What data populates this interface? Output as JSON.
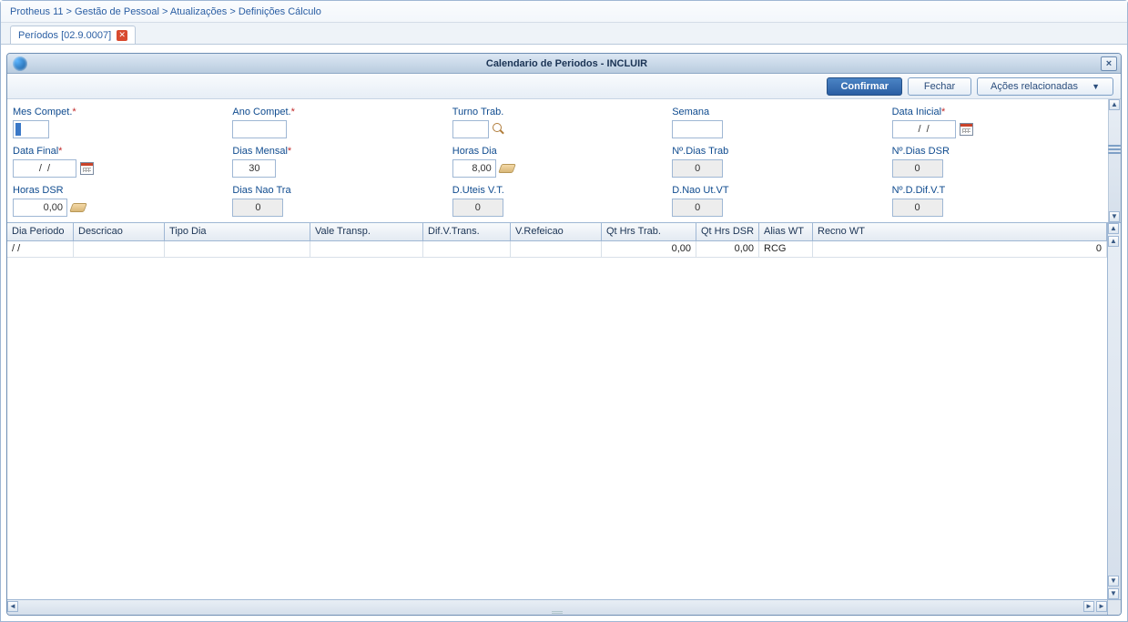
{
  "breadcrumb": "Protheus 11 > Gestão de Pessoal > Atualizações > Definições Cálculo",
  "tab": {
    "label": "Períodos [02.9.0007]"
  },
  "window": {
    "title": "Calendario de Periodos - INCLUIR"
  },
  "toolbar": {
    "confirm": "Confirmar",
    "close": "Fechar",
    "related": "Ações relacionadas"
  },
  "fields": {
    "mesCompet": {
      "label": "Mes Compet."
    },
    "anoCompet": {
      "label": "Ano Compet.",
      "value": ""
    },
    "turnoTrab": {
      "label": "Turno Trab.",
      "value": ""
    },
    "semana": {
      "label": "Semana",
      "value": ""
    },
    "dataInicial": {
      "label": "Data Inicial",
      "value": "/  /"
    },
    "dataFinal": {
      "label": "Data Final",
      "value": "/  /"
    },
    "diasMensal": {
      "label": "Dias Mensal",
      "value": "30"
    },
    "horasDia": {
      "label": "Horas Dia",
      "value": "8,00"
    },
    "nDiasTrab": {
      "label": "Nº.Dias Trab",
      "value": "0"
    },
    "nDiasDSR": {
      "label": "Nº.Dias DSR",
      "value": "0"
    },
    "horasDSR": {
      "label": "Horas DSR",
      "value": "0,00"
    },
    "diasNaoTra": {
      "label": "Dias Nao Tra",
      "value": "0"
    },
    "dUteisVT": {
      "label": "D.Uteis V.T.",
      "value": "0"
    },
    "dNaoUtVT": {
      "label": "D.Nao Ut.VT",
      "value": "0"
    },
    "nDDifVT": {
      "label": "Nº.D.Dif.V.T",
      "value": "0"
    }
  },
  "grid": {
    "headers": [
      "Dia Periodo",
      "Descricao",
      "Tipo Dia",
      "Vale Transp.",
      "Dif.V.Trans.",
      "V.Refeicao",
      "Qt Hrs Trab.",
      "Qt Hrs DSR",
      "Alias WT",
      "Recno WT"
    ],
    "rows": [
      {
        "diaPeriodo": "/  /",
        "descricao": "",
        "tipoDia": "",
        "valeTransp": "",
        "difVTrans": "",
        "vRefeicao": "",
        "qtHrsTrab": "0,00",
        "qtHrsDSR": "0,00",
        "aliasWT": "RCG",
        "recnoWT": "0"
      }
    ]
  }
}
